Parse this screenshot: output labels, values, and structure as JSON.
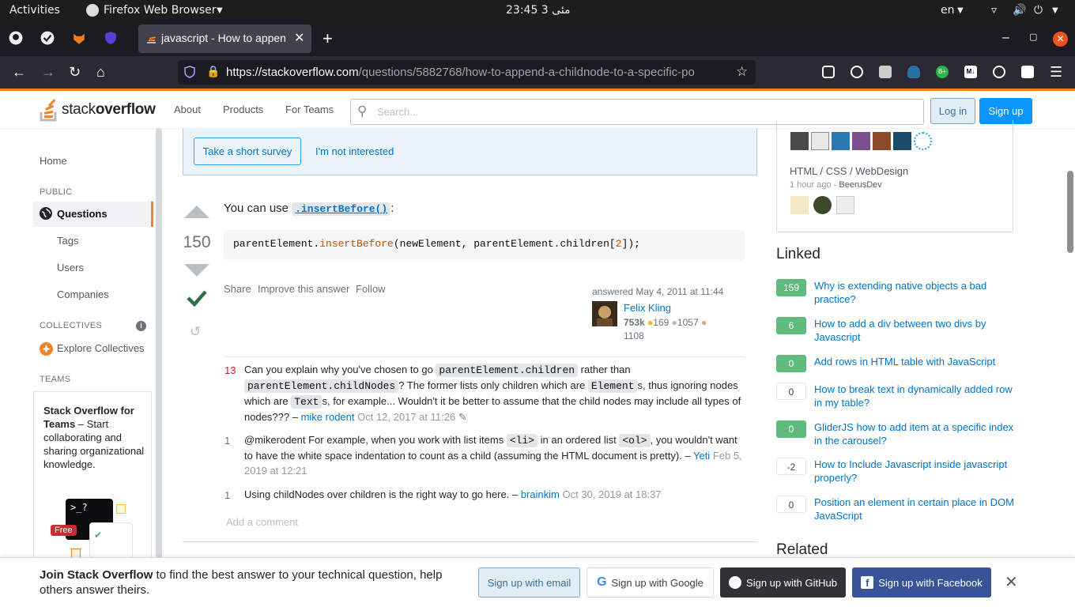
{
  "os": {
    "activities": "Activities",
    "app_name": "Firefox Web Browser",
    "clock": "23:45  3 مئى",
    "lang": "en"
  },
  "browser": {
    "tab_title": "javascript - How to appen",
    "url_host": "https://stackoverflow.com",
    "url_path": "/questions/5882768/how-to-append-a-childnode-to-a-specific-po"
  },
  "so": {
    "about": "About",
    "products": "Products",
    "for_teams": "For Teams",
    "search_placeholder": "Search...",
    "login": "Log in",
    "signup": "Sign up"
  },
  "sidebar": {
    "home": "Home",
    "public": "PUBLIC",
    "questions": "Questions",
    "tags": "Tags",
    "users": "Users",
    "companies": "Companies",
    "collectives": "COLLECTIVES",
    "explore_collectives": "Explore Collectives",
    "teams": "TEAMS",
    "teams_title": "Stack Overflow for Teams",
    "teams_text": " – Start collaborating and sharing organizational knowledge.",
    "free_badge": "Free",
    "terminal_text": ">_?"
  },
  "survey": {
    "take": "Take a short survey",
    "not_interested": "I'm not interested"
  },
  "answer": {
    "score": "150",
    "intro": "You can use ",
    "method": ".insertBefore()",
    "colon": ":",
    "code": {
      "obj": "parentElement.",
      "fn": "insertBefore",
      "args_a": "(newElement, parentElement.children[",
      "num": "2",
      "args_b": "]);"
    },
    "share": "Share",
    "improve": "Improve this answer",
    "follow": "Follow",
    "answered": "answered May 4, 2011 at 11:44",
    "user": {
      "name": "Felix Kling",
      "rep": "753k",
      "gold": "169",
      "silver": "1057",
      "bronze": "1108"
    }
  },
  "comments": [
    {
      "score": "13",
      "p1": "Can you explain why you've chosen to go ",
      "c1": "parentElement.children",
      "p2": " rather than ",
      "c2": "parentElement.childNodes",
      "p3": "? The former lists only children which are ",
      "c3": "Element",
      "p4": "s, thus ignoring nodes which are ",
      "c4": "Text",
      "p5": "s, for example... Wouldn't it be better to assume that the child nodes may include all types of nodes??? – ",
      "user": "mike rodent",
      "date": "Oct 12, 2017 at 11:26"
    },
    {
      "score": "1",
      "p1": "@mikerodent For example, when you work with list items ",
      "c1": "<li>",
      "p2": " in an ordered list ",
      "c2": "<ol>",
      "p3": ", you wouldn't want to have the white space indentation to count as a child (assuming the HTML document is pretty). – ",
      "user": "Yeti",
      "date": "Feb 5, 2019 at 12:21"
    },
    {
      "score": "1",
      "p1": "Using childNodes over children is the right way to go here. – ",
      "user": "brainkim",
      "date": "Oct 30, 2019 at 18:37"
    }
  ],
  "add_comment": "Add a comment",
  "right": {
    "collective_title": "HTML / CSS / WebDesign",
    "collective_meta_time": "1 hour ago - ",
    "collective_meta_user": "BeerusDev",
    "linked_heading": "Linked",
    "related_heading": "Related",
    "linked": [
      {
        "score": "159",
        "title": "Why is extending native objects a bad practice?",
        "accepted": true
      },
      {
        "score": "6",
        "title": "How to add a div between two divs by Javascript",
        "accepted": true
      },
      {
        "score": "0",
        "title": "Add rows in HTML table with JavaScript",
        "accepted": true
      },
      {
        "score": "0",
        "title": "How to break text in dynamically added row in my table?",
        "accepted": false
      },
      {
        "score": "0",
        "title": "GliderJS how to add item at a specific index in the carousel?",
        "accepted": true
      },
      {
        "score": "-2",
        "title": "How to Include Javascript inside javascript properly?",
        "accepted": false
      },
      {
        "score": "0",
        "title": "Position an element in certain place in DOM JavaScript",
        "accepted": false
      }
    ]
  },
  "banner": {
    "join_bold": "Join Stack Overflow",
    "join_text": " to find the best answer to your technical question, help others answer theirs.",
    "email": "Sign up with email",
    "google": "Sign up with Google",
    "github": "Sign up with GitHub",
    "facebook": "Sign up with Facebook"
  },
  "colors": {
    "so_orange": "#f48225",
    "link": "#0074cc",
    "accepted_green": "#2f6f44",
    "accept_bg": "#5eba7d"
  }
}
